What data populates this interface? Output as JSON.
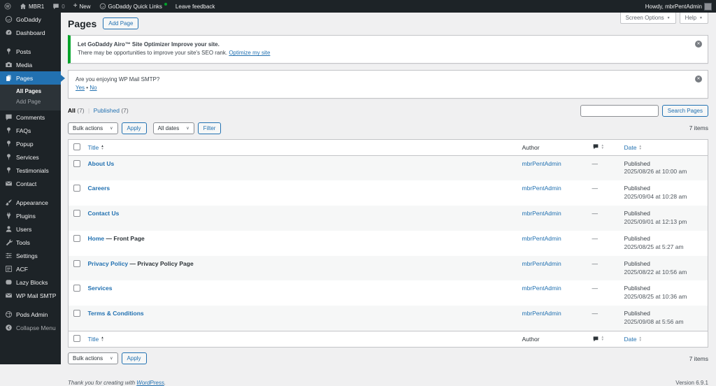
{
  "colors": {
    "admin_bar_bg": "#1d2327",
    "accent_blue": "#2271b1",
    "notice_green": "#00a32a",
    "online_dot_green": "#00a32a",
    "content_bg": "#f0f0f1"
  },
  "icons": {
    "plus": "+",
    "chevron_down": "▼",
    "select_chevron": "∨",
    "dismiss_x": "✕",
    "sort_up": "▲",
    "sort_down": "▼",
    "bullet": "•"
  },
  "admin_bar": {
    "site_name": "MBR1",
    "comments_count": "0",
    "new_label": "New",
    "quick_links_label": "GoDaddy Quick Links",
    "feedback_label": "Leave feedback",
    "howdy": "Howdy, mbrPentAdmin"
  },
  "sidebar": {
    "items": [
      {
        "label": "GoDaddy",
        "icon": "godaddy-icon"
      },
      {
        "label": "Dashboard",
        "icon": "dashboard-icon"
      },
      {
        "type": "separator"
      },
      {
        "label": "Posts",
        "icon": "pin-icon"
      },
      {
        "label": "Media",
        "icon": "media-icon"
      },
      {
        "label": "Pages",
        "icon": "pages-icon",
        "active": true,
        "submenu": [
          {
            "label": "All Pages",
            "current": true
          },
          {
            "label": "Add Page"
          }
        ]
      },
      {
        "label": "Comments",
        "icon": "comment-icon"
      },
      {
        "label": "FAQs",
        "icon": "pin-icon"
      },
      {
        "label": "Popup",
        "icon": "pin-icon"
      },
      {
        "label": "Services",
        "icon": "pin-icon"
      },
      {
        "label": "Testimonials",
        "icon": "pin-icon"
      },
      {
        "label": "Contact",
        "icon": "mail-icon"
      },
      {
        "type": "separator"
      },
      {
        "label": "Appearance",
        "icon": "appearance-icon"
      },
      {
        "label": "Plugins",
        "icon": "plugins-icon"
      },
      {
        "label": "Users",
        "icon": "users-icon"
      },
      {
        "label": "Tools",
        "icon": "tools-icon"
      },
      {
        "label": "Settings",
        "icon": "settings-icon"
      },
      {
        "label": "ACF",
        "icon": "acf-icon"
      },
      {
        "label": "Lazy Blocks",
        "icon": "lazyblocks-icon"
      },
      {
        "label": "WP Mail SMTP",
        "icon": "smtp-icon"
      },
      {
        "type": "separator"
      },
      {
        "label": "Pods Admin",
        "icon": "pods-icon"
      },
      {
        "label": "Collapse Menu",
        "icon": "collapse-icon",
        "dim": true
      }
    ]
  },
  "page": {
    "title": "Pages",
    "add_button": "Add Page",
    "screen_options": "Screen Options",
    "help": "Help"
  },
  "notices": {
    "godaddy": {
      "title": "Let GoDaddy Airo™ Site Optimizer Improve your site.",
      "body": "There may be opportunities to improve your site's SEO rank.",
      "link": "Optimize my site"
    },
    "smtp": {
      "question": "Are you enjoying WP Mail SMTP?",
      "yes": "Yes",
      "no": "No"
    }
  },
  "views": {
    "all": "All",
    "all_count": "(7)",
    "published": "Published",
    "published_count": "(7)"
  },
  "toolbar": {
    "bulk_actions": "Bulk actions",
    "apply": "Apply",
    "all_dates": "All dates",
    "filter": "Filter",
    "search_button": "Search Pages",
    "items_count": "7 items"
  },
  "table": {
    "columns": {
      "title": "Title",
      "author": "Author",
      "date": "Date"
    },
    "rows": [
      {
        "title": "About Us",
        "suffix": "",
        "author": "mbrPentAdmin",
        "comments": "—",
        "status": "Published",
        "date": "2025/08/26 at 10:00 am"
      },
      {
        "title": "Careers",
        "suffix": "",
        "author": "mbrPentAdmin",
        "comments": "—",
        "status": "Published",
        "date": "2025/09/04 at 10:28 am"
      },
      {
        "title": "Contact Us",
        "suffix": "",
        "author": "mbrPentAdmin",
        "comments": "—",
        "status": "Published",
        "date": "2025/09/01 at 12:13 pm"
      },
      {
        "title": "Home",
        "suffix": " — Front Page",
        "author": "mbrPentAdmin",
        "comments": "—",
        "status": "Published",
        "date": "2025/08/25 at 5:27 am"
      },
      {
        "title": "Privacy Policy",
        "suffix": " — Privacy Policy Page",
        "author": "mbrPentAdmin",
        "comments": "—",
        "status": "Published",
        "date": "2025/08/22 at 10:56 am"
      },
      {
        "title": "Services",
        "suffix": "",
        "author": "mbrPentAdmin",
        "comments": "—",
        "status": "Published",
        "date": "2025/08/25 at 10:36 am"
      },
      {
        "title": "Terms & Conditions",
        "suffix": "",
        "author": "mbrPentAdmin",
        "comments": "—",
        "status": "Published",
        "date": "2025/09/08 at 5:56 am"
      }
    ]
  },
  "footer": {
    "thanks_prefix": "Thank you for creating with",
    "wordpress_link": "WordPress",
    "thanks_suffix": ".",
    "version": "Version 6.9.1"
  }
}
